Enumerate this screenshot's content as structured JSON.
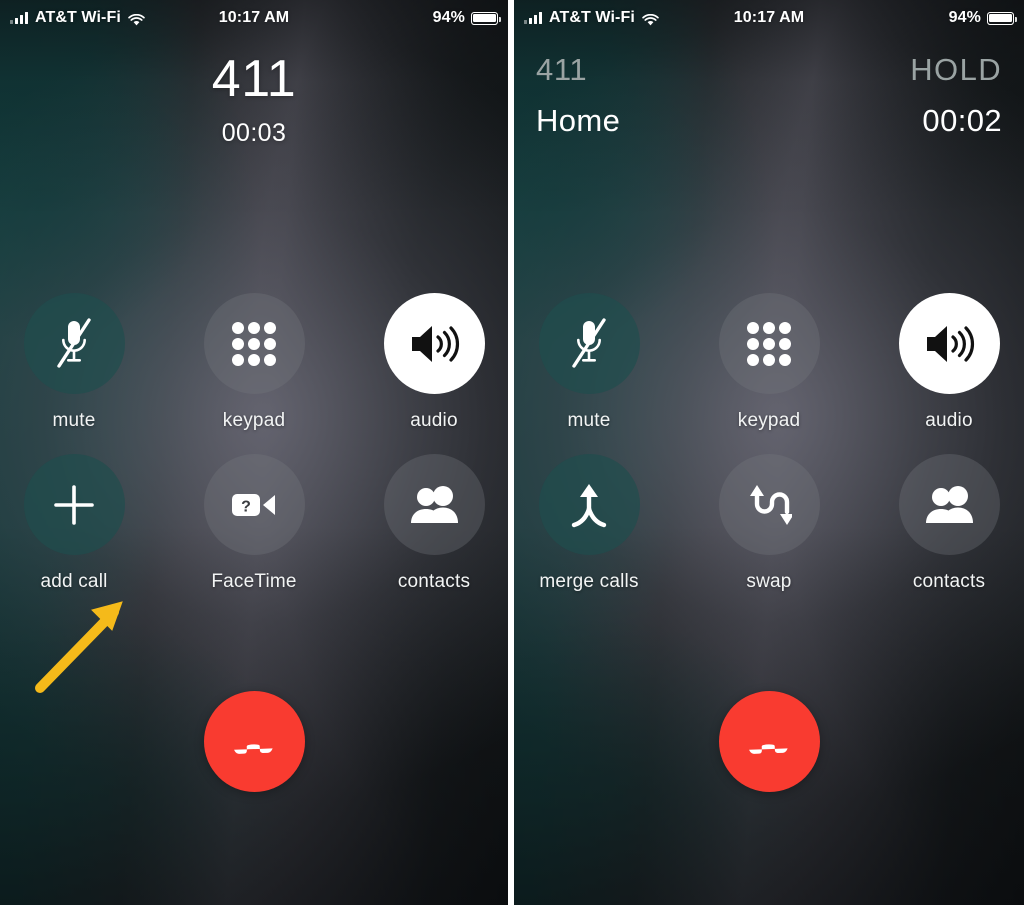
{
  "meta": {
    "accent_red": "#f93b30",
    "accent_arrow": "#f5ba1a",
    "active_button_bg": "#ffffff",
    "teal_button_bg": "rgba(31,78,78,0.66)",
    "gray_button_bg": "rgba(118,122,126,0.33)"
  },
  "status_bar": {
    "carrier": "AT&T Wi-Fi",
    "time": "10:17 AM",
    "battery_percent": "94%",
    "signal_icon": "cellular-bars-icon",
    "wifi_icon": "wifi-icon",
    "battery_icon": "battery-icon"
  },
  "panels": [
    {
      "id": "single-call",
      "header": {
        "layout": "single",
        "number": "411",
        "timer": "00:03"
      },
      "buttons": [
        {
          "name": "mute",
          "label": "mute",
          "icon": "microphone-slash-icon",
          "style": "teal"
        },
        {
          "name": "keypad",
          "label": "keypad",
          "icon": "keypad-dots-icon",
          "style": "gray"
        },
        {
          "name": "audio",
          "label": "audio",
          "icon": "speaker-waves-icon",
          "style": "white"
        },
        {
          "name": "add-call",
          "label": "add call",
          "icon": "plus-icon",
          "style": "teal"
        },
        {
          "name": "facetime",
          "label": "FaceTime",
          "icon": "video-camera-question-icon",
          "style": "gray"
        },
        {
          "name": "contacts",
          "label": "contacts",
          "icon": "contacts-people-icon",
          "style": "gray"
        }
      ],
      "end_call": {
        "label": "end call",
        "icon": "phone-down-icon"
      },
      "annotation": {
        "icon": "arrow-up-right-icon",
        "points_at": "add call"
      }
    },
    {
      "id": "two-calls",
      "header": {
        "layout": "dual",
        "held_number": "411",
        "held_status": "HOLD",
        "active_name": "Home",
        "active_timer": "00:02"
      },
      "buttons": [
        {
          "name": "mute",
          "label": "mute",
          "icon": "microphone-slash-icon",
          "style": "teal"
        },
        {
          "name": "keypad",
          "label": "keypad",
          "icon": "keypad-dots-icon",
          "style": "gray"
        },
        {
          "name": "audio",
          "label": "audio",
          "icon": "speaker-waves-icon",
          "style": "white"
        },
        {
          "name": "merge-calls",
          "label": "merge calls",
          "icon": "merge-arrows-icon",
          "style": "teal"
        },
        {
          "name": "swap",
          "label": "swap",
          "icon": "swap-arrows-icon",
          "style": "gray"
        },
        {
          "name": "contacts",
          "label": "contacts",
          "icon": "contacts-people-icon",
          "style": "gray"
        }
      ],
      "end_call": {
        "label": "end call",
        "icon": "phone-down-icon"
      },
      "annotation": {
        "icon": "arrow-up-right-icon",
        "points_at": "merge calls"
      }
    }
  ]
}
